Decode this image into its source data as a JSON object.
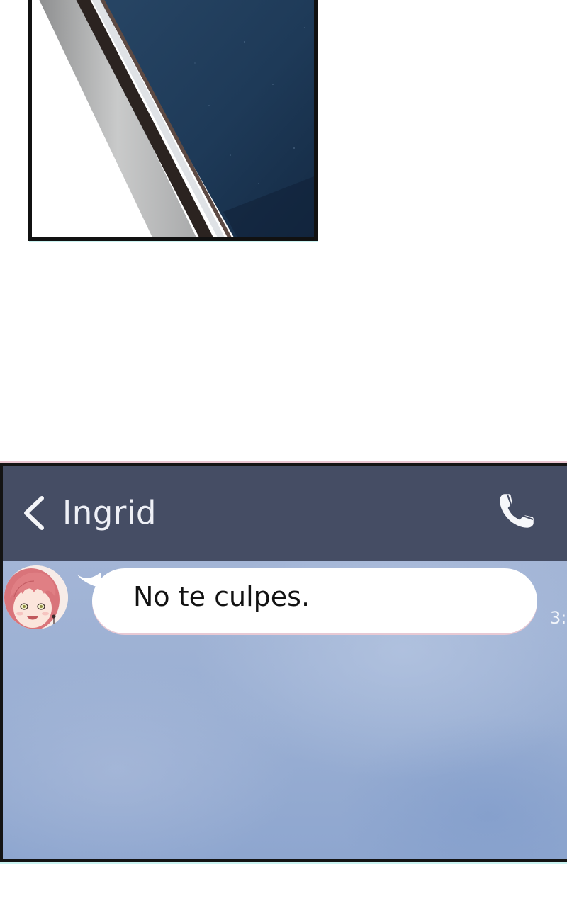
{
  "comic_panel": {
    "description_icon": "window-frame-illustration"
  },
  "chat": {
    "header": {
      "back_icon": "chevron-left-icon",
      "contact_name": "Ingrid",
      "call_icon": "phone-icon",
      "header_color": "#454d64"
    },
    "messages": [
      {
        "sender": "Ingrid",
        "avatar_icon": "avatar-pink-hair-girl",
        "text": "No te culpes.",
        "timestamp": "3:"
      }
    ],
    "background_color": "#9aaed0",
    "bubble_color": "#ffffff"
  }
}
